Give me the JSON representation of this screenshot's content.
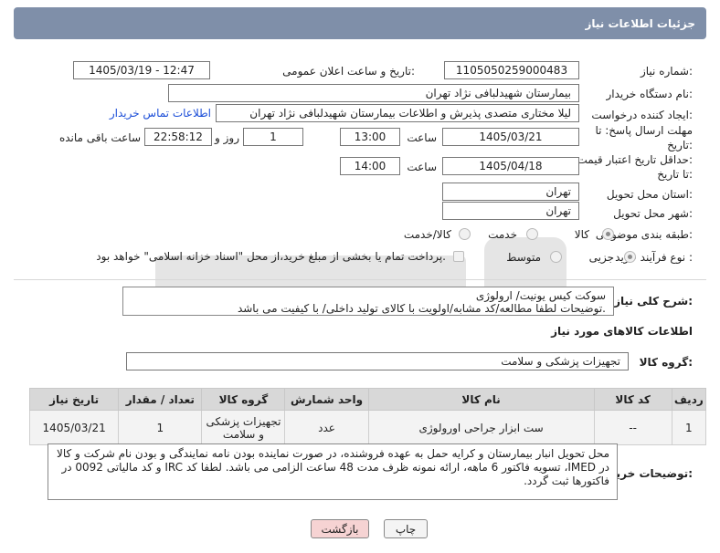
{
  "header": {
    "title": "جزئیات اطلاعات نیاز"
  },
  "fields": {
    "need_number": {
      "label": "شماره نیاز:",
      "value": "1105050259000483"
    },
    "announce_datetime": {
      "label": "تاریخ و ساعت اعلان عمومی:",
      "value": "1405/03/19 - 12:47"
    },
    "buyer_org": {
      "label": "نام دستگاه خریدار:",
      "value": "بیمارستان شهیدلبافی نژاد تهران"
    },
    "requester": {
      "label": "ایجاد کننده درخواست:",
      "value": "لیلا مختاری متصدی پذیرش و اطلاعات بیمارستان شهیدلبافی نژاد تهران",
      "contact_link": "اطلاعات تماس خریدار"
    },
    "reply_deadline": {
      "label_line1": "مهلت ارسال پاسخ: تا",
      "label_line2": "تاریخ:",
      "date": "1405/03/21",
      "time_label": "ساعت",
      "time": "13:00",
      "days": "1",
      "days_label": "روز و",
      "remaining": "22:58:12",
      "remaining_label": "ساعت باقی مانده"
    },
    "price_validity": {
      "label_line1": "حداقل تاریخ اعتبار قیمت:",
      "label_line2": "تا تاریخ:",
      "date": "1405/04/18",
      "time_label": "ساعت",
      "time": "14:00"
    },
    "delivery_province": {
      "label": "استان محل تحویل:",
      "value": "تهران"
    },
    "delivery_city": {
      "label": "شهر محل تحویل:",
      "value": "تهران"
    },
    "category": {
      "label": "طبقه بندی موضوعی:",
      "options": [
        "کالا",
        "خدمت",
        "کالا/خدمت"
      ],
      "selected": "کالا"
    },
    "purchase_type": {
      "label": "نوع فرآیند خرید :",
      "options": [
        "جزیی",
        "متوسط"
      ],
      "payment_note": "پرداخت تمام یا بخشی از مبلغ خرید،از محل \"اسناد خزانه اسلامی\" خواهد بود."
    }
  },
  "summary": {
    "label": "شرح کلی نیاز:",
    "line1": "سوکت کیس یونیت/ ارولوژی",
    "line2": "توضیحات لطفا مطالعه/کد مشابه/اولویت با کالای تولید داخلی/ با کیفیت می باشد."
  },
  "goods_section": {
    "title": "اطلاعات کالاهای مورد نیاز",
    "group_label": "گروه کالا:",
    "group_value": "تجهیزات پزشکی و سلامت"
  },
  "table": {
    "headers": [
      "ردیف",
      "کد کالا",
      "نام کالا",
      "واحد شمارش",
      "گروه کالا",
      "تعداد / مقدار",
      "تاریخ نیاز"
    ],
    "rows": [
      {
        "row": "1",
        "code": "--",
        "name": "ست ابزار جراحی اورولوژی",
        "unit": "عدد",
        "group": "تجهیزات پزشکی و سلامت",
        "qty": "1",
        "date": "1405/03/21"
      }
    ]
  },
  "buyer_notes": {
    "label": "توضیحات خریدار:",
    "text": "محل تحویل انبار بیمارستان و کرایه حمل به عهده فروشنده، در صورت نماینده بودن نامه نمایندگی و بودن نام شرکت و کالا در IMED، تسویه فاکتور 6 ماهه، ارائه نمونه ظرف مدت 48 ساعت الزامی می باشد. لطفا کد IRC و کد مالیاتی 0092 در فاکتورها ثبت گردد."
  },
  "buttons": {
    "print": "چاپ",
    "back": "بازگشت"
  },
  "colors": {
    "header_bg": "#7f8fa9",
    "link": "#1d4fd8",
    "back_btn_bg": "#f6d3d3"
  }
}
